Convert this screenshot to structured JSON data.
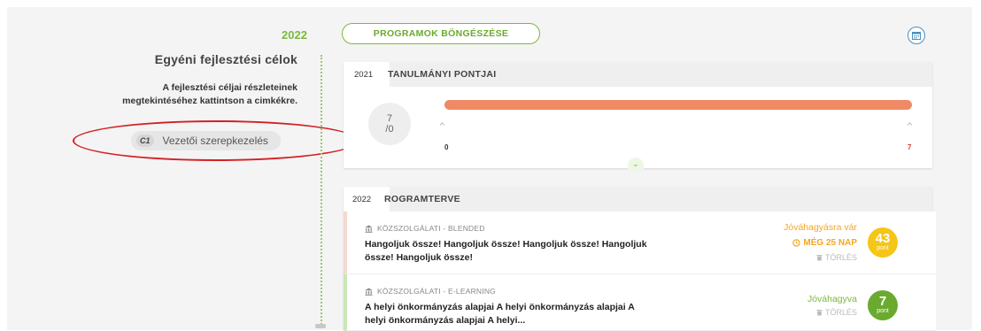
{
  "left": {
    "year": "2022",
    "title": "Egyéni fejlesztési célok",
    "description_lines": [
      "A fejlesztési céljai részleteinek",
      "megtekintéséhez kattintson a cimkékre."
    ],
    "tag": {
      "code": "C1",
      "label": "Vezetői szerepkezelés"
    }
  },
  "toolbar": {
    "browse_label": "PROGRAMOK BÖNGÉSZÉSE",
    "calendar_icon": "calendar-icon"
  },
  "study_points": {
    "year": "2021",
    "title": "TANULMÁNYI PONTJAI",
    "score_value": "7",
    "score_total": "/0",
    "bar_min": "0",
    "bar_max": "7",
    "progress_fraction": 1.0,
    "bar_color": "#f08a64"
  },
  "program_plan": {
    "year": "2022",
    "title": "ROGRAMTERVE",
    "items": [
      {
        "type": "KÖZSZOLGÁLATI - BLENDED",
        "title": "Hangoljuk össze! Hangoljuk össze! Hangoljuk össze! Hangoljuk össze! Hangoljuk össze!",
        "status": "Jóváhagyásra vár",
        "status_color": "#f5a623",
        "deadline": "MÉG 25 NAP",
        "delete": "TÖRLÉS",
        "points": "43",
        "points_label": "pont",
        "points_color": "#f5c518",
        "accent_color": "#f3d9cf"
      },
      {
        "type": "KÖZSZOLGÁLATI - E-LEARNING",
        "title": "A helyi önkormányzás alapjai A helyi önkormányzás alapjai A helyi önkormányzás alapjai A helyi...",
        "status": "Jóváhagyva",
        "status_color": "#7cb83b",
        "delete": "TÖRLÉS",
        "points": "7",
        "points_label": "pont",
        "points_color": "#6aaa2f",
        "accent_color": "#c9e8b6"
      }
    ]
  }
}
